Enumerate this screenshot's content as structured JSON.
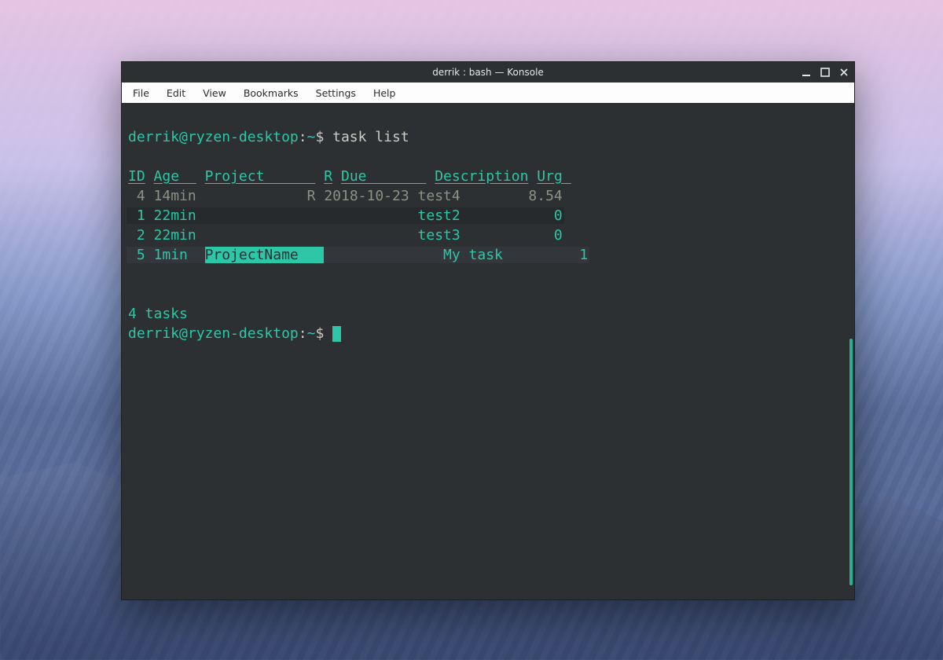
{
  "window": {
    "title": "derrik : bash — Konsole"
  },
  "menubar": {
    "items": [
      "File",
      "Edit",
      "View",
      "Bookmarks",
      "Settings",
      "Help"
    ]
  },
  "prompt": {
    "user_host": "derrik@ryzen-desktop",
    "colon": ":",
    "cwd": "~",
    "symbol": "$",
    "command": "task list"
  },
  "headers": {
    "id": "ID",
    "age": "Age  ",
    "project": "Project      ",
    "r": "R",
    "due": "Due       ",
    "description": "Description",
    "urg": "Urg "
  },
  "rows": [
    {
      "id": " 4",
      "age": "14min",
      "project": "           ",
      "r": "R",
      "due": "2018-10-23",
      "description": "test4       ",
      "urg": "8.54",
      "shade": "none",
      "color": "grey"
    },
    {
      "id": " 1",
      "age": "22min",
      "project": "           ",
      "r": " ",
      "due": "          ",
      "description": "test2       ",
      "urg": "   0",
      "shade": "dark",
      "color": "teal"
    },
    {
      "id": " 2",
      "age": "22min",
      "project": "           ",
      "r": " ",
      "due": "          ",
      "description": "test3       ",
      "urg": "   0",
      "shade": "none",
      "color": "teal"
    },
    {
      "id": " 5",
      "age": "1min ",
      "project": "ProjectName   ",
      "r": " ",
      "due": "          ",
      "description": "My task     ",
      "urg": "   1",
      "shade": "light",
      "color": "teal",
      "project_inverted": true
    }
  ],
  "summary": "4 tasks"
}
